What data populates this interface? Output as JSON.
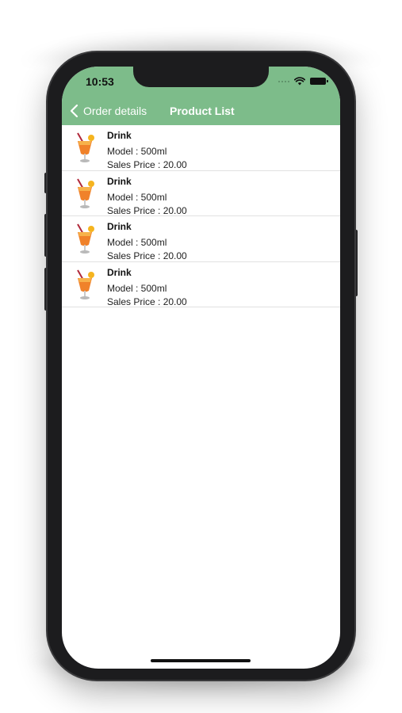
{
  "status_bar": {
    "time": "10:53"
  },
  "nav": {
    "back_label": "Order details",
    "title": "Product List"
  },
  "products": [
    {
      "name": "Drink",
      "model": "Model : 500ml",
      "price": "Sales Price : 20.00",
      "icon": "cocktail-icon"
    },
    {
      "name": "Drink",
      "model": "Model : 500ml",
      "price": "Sales Price : 20.00",
      "icon": "cocktail-icon"
    },
    {
      "name": "Drink",
      "model": "Model : 500ml",
      "price": "Sales Price : 20.00",
      "icon": "cocktail-icon"
    },
    {
      "name": "Drink",
      "model": "Model : 500ml",
      "price": "Sales Price : 20.00",
      "icon": "cocktail-icon"
    }
  ],
  "colors": {
    "header_green": "#7dbc8a",
    "drink_orange": "#f0822a"
  }
}
